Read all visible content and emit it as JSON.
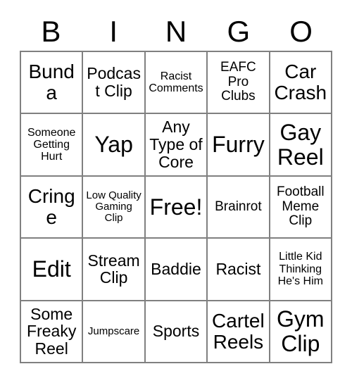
{
  "card": {
    "header_letters": [
      "B",
      "I",
      "N",
      "G",
      "O"
    ],
    "rows": [
      [
        {
          "label": "Bunda",
          "size": "lg"
        },
        {
          "label": "Podcast Clip",
          "size": "md"
        },
        {
          "label": "Racist Comments",
          "size": "xs"
        },
        {
          "label": "EAFC Pro Clubs",
          "size": "sm"
        },
        {
          "label": "Car Crash",
          "size": "lg"
        }
      ],
      [
        {
          "label": "Someone Getting Hurt",
          "size": "xs"
        },
        {
          "label": "Yap",
          "size": "xl"
        },
        {
          "label": "Any Type of Core",
          "size": "md"
        },
        {
          "label": "Furry",
          "size": "xl"
        },
        {
          "label": "Gay Reel",
          "size": "xl"
        }
      ],
      [
        {
          "label": "Cringe",
          "size": "lg"
        },
        {
          "label": "Low Quality Gaming Clip",
          "size": "xxs"
        },
        {
          "label": "Free!",
          "size": "xl"
        },
        {
          "label": "Brainrot",
          "size": "sm"
        },
        {
          "label": "Football Meme Clip",
          "size": "sm"
        }
      ],
      [
        {
          "label": "Edit",
          "size": "xl"
        },
        {
          "label": "Stream Clip",
          "size": "md"
        },
        {
          "label": "Baddie",
          "size": "md"
        },
        {
          "label": "Racist",
          "size": "md"
        },
        {
          "label": "Little Kid Thinking He's Him",
          "size": "xs"
        }
      ],
      [
        {
          "label": "Some Freaky Reel",
          "size": "md"
        },
        {
          "label": "Jumpscare",
          "size": "xxs"
        },
        {
          "label": "Sports",
          "size": "md"
        },
        {
          "label": "Cartel Reels",
          "size": "lg"
        },
        {
          "label": "Gym Clip",
          "size": "xl"
        }
      ]
    ],
    "colors": {
      "background": "#ffffff",
      "text": "#000000",
      "grid_line": "#808080"
    }
  }
}
